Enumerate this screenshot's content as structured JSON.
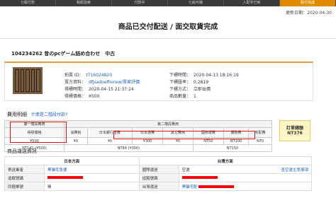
{
  "nav": {
    "tabs": [
      "七級付款",
      "輸組指索",
      "付款中",
      "七給可幾",
      "入配宇已到",
      "取付完成"
    ]
  },
  "header": {
    "updated": "更新日期：2020-04-30",
    "title": "商品已交付配送 / 面交取貨完成"
  },
  "order": {
    "id_line": "104234262 昔のpcゲーム詰め合わせ　中古"
  },
  "info": {
    "auction_id_label": "拍賣 ID：",
    "auction_id": "t716024820",
    "seller_label": "賣方資料：",
    "seller": "dfjsadoefhorew/賣家評價",
    "won_label": "得標時間：",
    "won": "2020-04-15 21:37:24",
    "price_label": "得標價格：",
    "price": "¥500",
    "bid_time_label": "下標時間：",
    "bid_time": "2020-04-13 18:16:19",
    "rate_label": "下標匯率：",
    "rate": "0.2819",
    "method_label": "下標方式：",
    "method": "立即出價",
    "qty_label": "商品數量：",
    "qty": "1"
  },
  "fees": {
    "section": "費用明細",
    "help": "什麼是二階段付款?",
    "stage1": "第一階段費用",
    "stage2": "第二階段費用",
    "c1": "得標價格",
    "c2": "消費稅",
    "c3": "日本銀行匯費",
    "c4": "日本運費",
    "c5": "其它費用",
    "c6": "國際運費",
    "c7": "服務費",
    "c8": "宅配費",
    "v1": "¥500",
    "v2": "¥0",
    "v3": "¥0",
    "v4": "¥300",
    "v5": "¥0",
    "v6": "NT50",
    "v7": "NT100",
    "v8": "NT0",
    "s1": "NT141 (¥500)",
    "s2a": "NT84 (¥300)",
    "s2b": "NT150",
    "total_label": "訂單總額",
    "total": "NT376"
  },
  "shipping": {
    "section": "商品運送資訊",
    "jp_head": "日本方面",
    "tw_head": "台灣方面",
    "jp_carrier_label": "寄送業者",
    "jp_carrier": "黑貓宅急便",
    "jp_track_label": "追蹤號碼",
    "jp_note_label": "同捆單號",
    "jp_note": "無",
    "tw_intl_label": "國際運送",
    "tw_intl": "空運",
    "tw_query": "查空運主意事項",
    "tw_track_label": "追蹤號碼",
    "tw_carrier_label": "台灣運送",
    "tw_carrier": "黑貓宅配"
  }
}
